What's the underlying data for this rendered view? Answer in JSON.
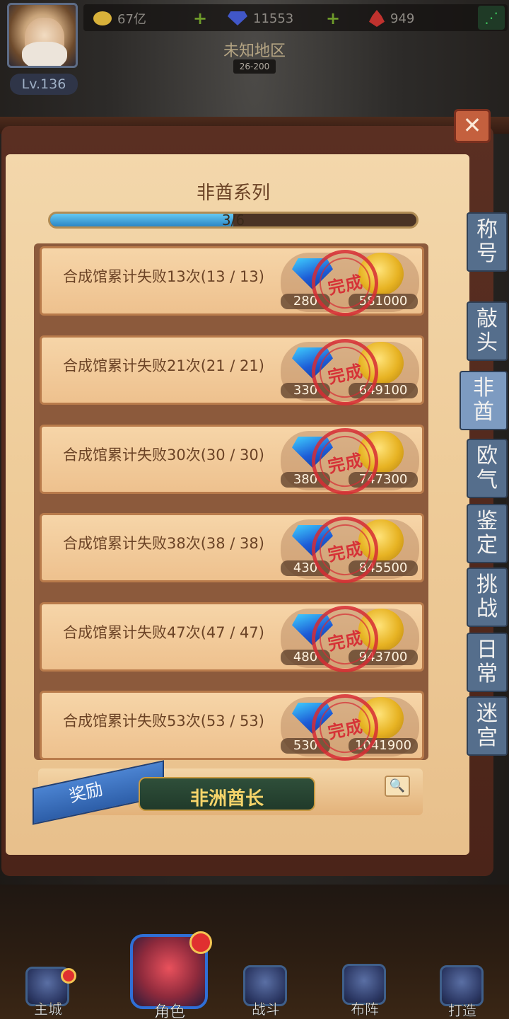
{
  "top_bar": {
    "level": "Lv.136",
    "resources": [
      {
        "icon": "gold-coin-icon",
        "value": "67亿"
      },
      {
        "icon": "diamond-icon",
        "value": "11553"
      },
      {
        "icon": "blood-drop-icon",
        "value": "949"
      }
    ],
    "add_symbol": "+",
    "share_symbol": "⋰"
  },
  "region": {
    "name": "未知地区",
    "range": "26-200"
  },
  "panel": {
    "title": "非酋系列",
    "close_symbol": "✕",
    "progress": {
      "text": "3/6",
      "fraction": 0.5
    },
    "tasks": [
      {
        "text": "合成馆累计失败13次(13 / 13)",
        "gem": "280",
        "coin": "581000",
        "status": "完成"
      },
      {
        "text": "合成馆累计失败21次(21 / 21)",
        "gem": "330",
        "coin": "649100",
        "status": "完成"
      },
      {
        "text": "合成馆累计失败30次(30 / 30)",
        "gem": "380",
        "coin": "747300",
        "status": "完成"
      },
      {
        "text": "合成馆累计失败38次(38 / 38)",
        "gem": "430",
        "coin": "845500",
        "status": "完成"
      },
      {
        "text": "合成馆累计失败47次(47 / 47)",
        "gem": "480",
        "coin": "943700",
        "status": "完成"
      },
      {
        "text": "合成馆累计失败53次(53 / 53)",
        "gem": "530",
        "coin": "1041900",
        "status": "完成"
      }
    ],
    "reward": {
      "tag": "奖励",
      "title": "非洲酋长",
      "magnify_symbol": "🔍"
    }
  },
  "side_tabs": [
    {
      "label": "称号",
      "active": false
    },
    {
      "label": "敲头",
      "active": false
    },
    {
      "label": "非酋",
      "active": true
    },
    {
      "label": "欧气",
      "active": false
    },
    {
      "label": "鉴定",
      "active": false
    },
    {
      "label": "挑战",
      "active": false
    },
    {
      "label": "日常",
      "active": false
    },
    {
      "label": "迷宫",
      "active": false
    }
  ],
  "bottom_nav": [
    {
      "label": "主城",
      "icon": "castle-icon",
      "badge": true
    },
    {
      "label": "角色",
      "icon": "knight-helmet-icon",
      "badge": true
    },
    {
      "label": "战斗",
      "icon": "crossed-swords-icon",
      "badge": false
    },
    {
      "label": "布阵",
      "icon": "horse-head-icon",
      "badge": false
    },
    {
      "label": "打造",
      "icon": "anvil-hammer-icon",
      "badge": false
    }
  ]
}
